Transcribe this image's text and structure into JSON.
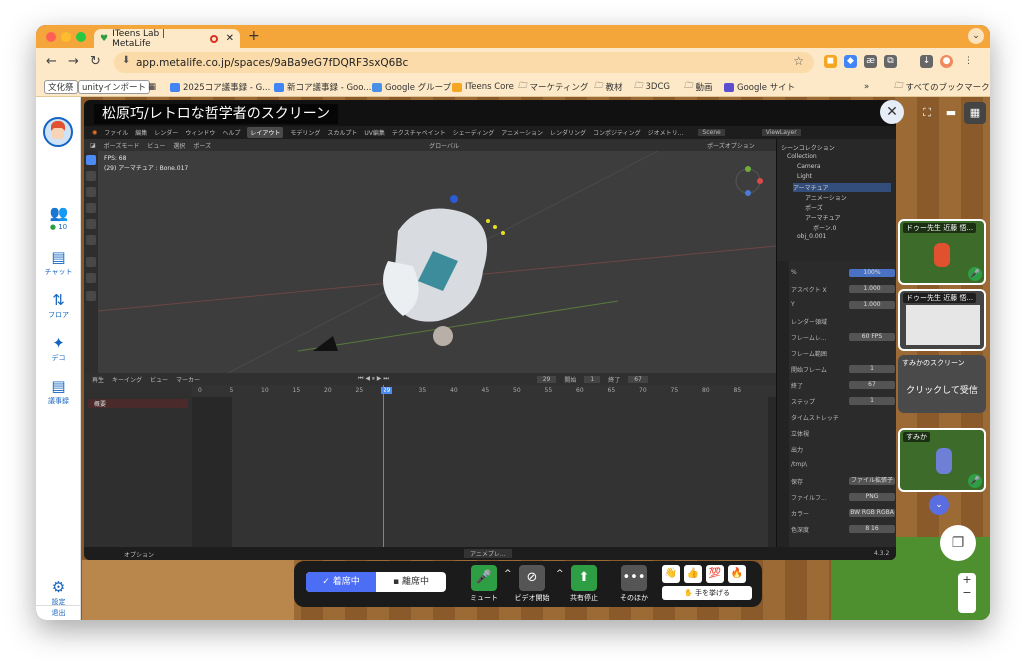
{
  "browser": {
    "tab_title": "ITeens Lab | MetaLife",
    "url": "app.metalife.co.jp/spaces/9aBa9eG7fDQRF3sxQ6Bc",
    "bookmarks": [
      "文化祭",
      "unityインポート",
      "2025コア議事録 - G...",
      "新コア議事録 - Goo...",
      "Google グループ",
      "ITeens Core",
      "マーケティング",
      "教材",
      "3DCG",
      "動画",
      "Google サイト",
      "すべてのブックマーク"
    ]
  },
  "sidebar": {
    "user_count": "10",
    "items": [
      {
        "label": "チャット"
      },
      {
        "label": "フロア"
      },
      {
        "label": "デコ"
      },
      {
        "label": "議事録"
      },
      {
        "label": "設定"
      },
      {
        "label": "退出"
      }
    ]
  },
  "screen_share": {
    "title": "松原巧/レトロな哲学者のスクリーン"
  },
  "blender": {
    "menu": [
      "ファイル",
      "編集",
      "レンダー",
      "ウィンドウ",
      "ヘルプ",
      "レイアウト",
      "モデリング",
      "スカルプト",
      "UV編集",
      "テクスチャペイント",
      "シェーディング",
      "アニメーション",
      "レンダリング",
      "コンポジティング",
      "ジオメトリ..."
    ],
    "scene": "Scene",
    "view_layer": "ViewLayer",
    "viewport_header": [
      "ポーズモード",
      "ビュー",
      "選択",
      "ポーズ",
      "グローバル",
      "ポーズオプション"
    ],
    "fps": "FPS: 68",
    "bone_info": "(29) アーマチュア : Bone.017",
    "timeline_header": [
      "再生",
      "キーイング",
      "ビュー",
      "マーカー"
    ],
    "current_frame": "29",
    "start_label": "開始",
    "start": "1",
    "end_label": "終了",
    "end": "67",
    "ticks": [
      "0",
      "5",
      "10",
      "15",
      "20",
      "25",
      "29",
      "35",
      "40",
      "45",
      "50",
      "55",
      "60",
      "65",
      "70",
      "75",
      "80",
      "85"
    ],
    "channel": "概要",
    "outliner": [
      "シーンコレクション",
      "Collection",
      "Camera",
      "Light",
      "アーマチュア",
      "アニメーション",
      "ポーズ",
      "アーマチュア",
      "ボーン.0",
      "obj_0.001"
    ],
    "props": [
      {
        "label": "%",
        "value": "100%"
      },
      {
        "label": "アスペクト X",
        "value": "1.000"
      },
      {
        "label": "Y",
        "value": "1.000"
      },
      {
        "label": "レンダー領域",
        "value": ""
      },
      {
        "label": "フレームレ...",
        "value": "60 FPS"
      },
      {
        "label": "フレーム範囲",
        "value": ""
      },
      {
        "label": "開始フレーム",
        "value": "1"
      },
      {
        "label": "終了",
        "value": "67"
      },
      {
        "label": "ステップ",
        "value": "1"
      },
      {
        "label": "タイムストレッチ",
        "value": ""
      },
      {
        "label": "立体視",
        "value": ""
      },
      {
        "label": "出力",
        "value": ""
      },
      {
        "label": "/tmp\\",
        "value": ""
      },
      {
        "label": "保存",
        "value": "ファイル拡張子"
      },
      {
        "label": "ファイルフ...",
        "value": "PNG"
      },
      {
        "label": "カラー",
        "value": "BW RGB RGBA"
      },
      {
        "label": "色深度",
        "value": "8  16"
      }
    ],
    "status_left": "オプション",
    "status_center": "アニメプレ...",
    "version": "4.3.2"
  },
  "cards": [
    {
      "label": "ドゥー先生 近藤 悟..."
    },
    {
      "label": "ドゥー先生 近藤 悟..."
    },
    {
      "label": "すみかのスクリーン",
      "button": "クリックして受信"
    },
    {
      "label": "すみか"
    }
  ],
  "bottombar": {
    "attend": "着席中",
    "leave": "離席中",
    "mute": "ミュート",
    "video": "ビデオ開始",
    "share_stop": "共有停止",
    "other": "そのほか",
    "raise_hand": "手を挙げる"
  },
  "colors": {
    "accent": "#4c6ef5",
    "browser_tab": "#f4a63b",
    "green": "#2e9e44"
  }
}
